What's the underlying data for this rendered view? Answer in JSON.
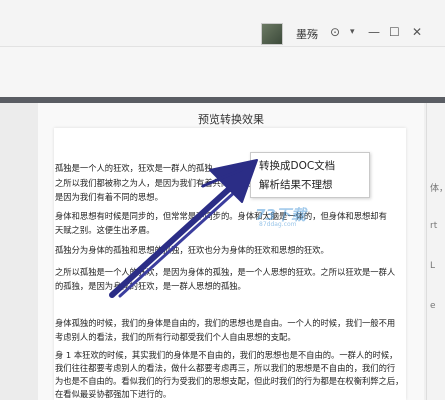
{
  "user": {
    "name": "墨殇"
  },
  "window": {
    "shield_glyph": "⊙",
    "dropdown": "▾",
    "minimize": "—",
    "maximize": "☐",
    "close": "✕"
  },
  "preview": {
    "title": "预览转换效果",
    "lines": [
      "孤独是一个人的狂欢，狂欢是一群人的孤独。",
      "之所以我们都被称之为人，是因为我们有着共同的特性，又有着不同的个体，",
      "是因为我们有着不同的思想。",
      "身体和思想有时候是同步的，但常常是不同步的。身体和大脑是一体的，但身体和思想却有",
      "天赋之别。这便生出矛盾。",
      "孤独分为身体的孤独和思想的孤独，狂欢也分为身体的狂欢和思想的狂欢。",
      "之所以孤独是一个人的狂欢，是因为身体的孤独，是一个人思想的狂欢。之所以狂欢是一群人",
      "的孤独，是因为身体的狂欢，是一群人思想的孤独。",
      "身体孤独的时候，我们的身体是自由的，我们的思想也是自由。一个人的时候，我们一般不用",
      "考虑别人的看法，我们的所有行动都受我们个人自由思想的支配。",
      "身 1 本狂欢的时候，其实我们的身体是不自由的，我们的思想也是不自由的。一群人的时候，",
      "我们往往都要考虑别人的看法，做什么都要考虑再三，所以我们的思想是不自由的，我们的行",
      "为也是不自由的。看似我们的行为受我们的思想支配，但此时我们的行为都是在权衡利弊之后，",
      "在看似最妥协都强加下进行的。"
    ]
  },
  "context_menu": {
    "items": [
      "转换成DOC文档",
      "解析结果不理想"
    ]
  },
  "watermark": {
    "text": "73下载",
    "sub": "87ddag.com"
  },
  "right_strip": {
    "items": [
      "体，",
      "rt",
      "L",
      "e"
    ]
  }
}
